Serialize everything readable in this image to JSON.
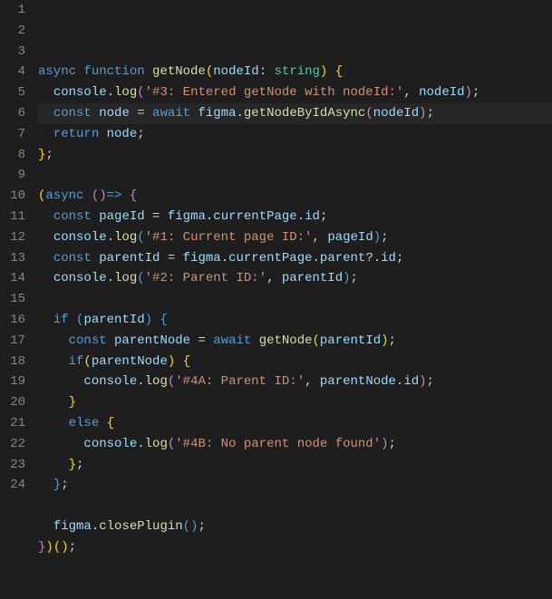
{
  "lines": [
    [
      {
        "txt": "async ",
        "cls": "tok-kw"
      },
      {
        "txt": "function ",
        "cls": "tok-kw"
      },
      {
        "txt": "getNode",
        "cls": "tok-fn"
      },
      {
        "txt": "(",
        "cls": "tok-brace"
      },
      {
        "txt": "nodeId",
        "cls": "tok-var"
      },
      {
        "txt": ": ",
        "cls": "tok-punc"
      },
      {
        "txt": "string",
        "cls": "tok-type"
      },
      {
        "txt": ") ",
        "cls": "tok-brace"
      },
      {
        "txt": "{",
        "cls": "tok-brace"
      }
    ],
    [
      {
        "txt": "  ",
        "cls": ""
      },
      {
        "txt": "console",
        "cls": "tok-var"
      },
      {
        "txt": ".",
        "cls": "tok-dot"
      },
      {
        "txt": "log",
        "cls": "tok-fn"
      },
      {
        "txt": "(",
        "cls": "tok-pur"
      },
      {
        "txt": "'#3: Entered getNode with nodeId:'",
        "cls": "tok-str"
      },
      {
        "txt": ", ",
        "cls": "tok-punc"
      },
      {
        "txt": "nodeId",
        "cls": "tok-var"
      },
      {
        "txt": ")",
        "cls": "tok-pur"
      },
      {
        "txt": ";",
        "cls": "tok-punc"
      }
    ],
    [
      {
        "txt": "  ",
        "cls": ""
      },
      {
        "txt": "const ",
        "cls": "tok-kw"
      },
      {
        "txt": "node",
        "cls": "tok-var"
      },
      {
        "txt": " = ",
        "cls": "tok-punc"
      },
      {
        "txt": "await ",
        "cls": "tok-kw"
      },
      {
        "txt": "figma",
        "cls": "tok-var"
      },
      {
        "txt": ".",
        "cls": "tok-dot"
      },
      {
        "txt": "getNodeByIdAsync",
        "cls": "tok-fn"
      },
      {
        "txt": "(",
        "cls": "tok-pur"
      },
      {
        "txt": "nodeId",
        "cls": "tok-var"
      },
      {
        "txt": ")",
        "cls": "tok-pur"
      },
      {
        "txt": ";",
        "cls": "tok-punc"
      }
    ],
    [
      {
        "txt": "  ",
        "cls": ""
      },
      {
        "txt": "return ",
        "cls": "tok-kw"
      },
      {
        "txt": "node",
        "cls": "tok-var"
      },
      {
        "txt": ";",
        "cls": "tok-punc"
      }
    ],
    [
      {
        "txt": "}",
        "cls": "tok-brace"
      },
      {
        "txt": ";",
        "cls": "tok-punc"
      }
    ],
    [],
    [
      {
        "txt": "(",
        "cls": "tok-brace"
      },
      {
        "txt": "async ",
        "cls": "tok-kw"
      },
      {
        "txt": "()",
        "cls": "tok-pur"
      },
      {
        "txt": "=> ",
        "cls": "tok-kw"
      },
      {
        "txt": "{",
        "cls": "tok-pur"
      }
    ],
    [
      {
        "txt": "  ",
        "cls": ""
      },
      {
        "txt": "const ",
        "cls": "tok-kw"
      },
      {
        "txt": "pageId",
        "cls": "tok-var"
      },
      {
        "txt": " = ",
        "cls": "tok-punc"
      },
      {
        "txt": "figma",
        "cls": "tok-var"
      },
      {
        "txt": ".",
        "cls": "tok-dot"
      },
      {
        "txt": "currentPage",
        "cls": "tok-var"
      },
      {
        "txt": ".",
        "cls": "tok-dot"
      },
      {
        "txt": "id",
        "cls": "tok-var"
      },
      {
        "txt": ";",
        "cls": "tok-punc"
      }
    ],
    [
      {
        "txt": "  ",
        "cls": ""
      },
      {
        "txt": "console",
        "cls": "tok-var"
      },
      {
        "txt": ".",
        "cls": "tok-dot"
      },
      {
        "txt": "log",
        "cls": "tok-fn"
      },
      {
        "txt": "(",
        "cls": "tok-blue"
      },
      {
        "txt": "'#1: Current page ID:'",
        "cls": "tok-str"
      },
      {
        "txt": ", ",
        "cls": "tok-punc"
      },
      {
        "txt": "pageId",
        "cls": "tok-var"
      },
      {
        "txt": ")",
        "cls": "tok-blue"
      },
      {
        "txt": ";",
        "cls": "tok-punc"
      }
    ],
    [
      {
        "txt": "  ",
        "cls": ""
      },
      {
        "txt": "const ",
        "cls": "tok-kw"
      },
      {
        "txt": "parentId",
        "cls": "tok-var"
      },
      {
        "txt": " = ",
        "cls": "tok-punc"
      },
      {
        "txt": "figma",
        "cls": "tok-var"
      },
      {
        "txt": ".",
        "cls": "tok-dot"
      },
      {
        "txt": "currentPage",
        "cls": "tok-var"
      },
      {
        "txt": ".",
        "cls": "tok-dot"
      },
      {
        "txt": "parent",
        "cls": "tok-var"
      },
      {
        "txt": "?.",
        "cls": "tok-punc"
      },
      {
        "txt": "id",
        "cls": "tok-var"
      },
      {
        "txt": ";",
        "cls": "tok-punc"
      }
    ],
    [
      {
        "txt": "  ",
        "cls": ""
      },
      {
        "txt": "console",
        "cls": "tok-var"
      },
      {
        "txt": ".",
        "cls": "tok-dot"
      },
      {
        "txt": "log",
        "cls": "tok-fn"
      },
      {
        "txt": "(",
        "cls": "tok-blue"
      },
      {
        "txt": "'#2: Parent ID:'",
        "cls": "tok-str"
      },
      {
        "txt": ", ",
        "cls": "tok-punc"
      },
      {
        "txt": "parentId",
        "cls": "tok-var"
      },
      {
        "txt": ")",
        "cls": "tok-blue"
      },
      {
        "txt": ";",
        "cls": "tok-punc"
      }
    ],
    [],
    [
      {
        "txt": "  ",
        "cls": ""
      },
      {
        "txt": "if ",
        "cls": "tok-kw"
      },
      {
        "txt": "(",
        "cls": "tok-blue"
      },
      {
        "txt": "parentId",
        "cls": "tok-var"
      },
      {
        "txt": ") ",
        "cls": "tok-blue"
      },
      {
        "txt": "{",
        "cls": "tok-blue"
      }
    ],
    [
      {
        "txt": "    ",
        "cls": ""
      },
      {
        "txt": "const ",
        "cls": "tok-kw"
      },
      {
        "txt": "parentNode",
        "cls": "tok-var"
      },
      {
        "txt": " = ",
        "cls": "tok-punc"
      },
      {
        "txt": "await ",
        "cls": "tok-kw"
      },
      {
        "txt": "getNode",
        "cls": "tok-fn"
      },
      {
        "txt": "(",
        "cls": "tok-brace"
      },
      {
        "txt": "parentId",
        "cls": "tok-var"
      },
      {
        "txt": ")",
        "cls": "tok-brace"
      },
      {
        "txt": ";",
        "cls": "tok-punc"
      }
    ],
    [
      {
        "txt": "    ",
        "cls": ""
      },
      {
        "txt": "if",
        "cls": "tok-kw"
      },
      {
        "txt": "(",
        "cls": "tok-brace"
      },
      {
        "txt": "parentNode",
        "cls": "tok-var"
      },
      {
        "txt": ") ",
        "cls": "tok-brace"
      },
      {
        "txt": "{",
        "cls": "tok-brace"
      }
    ],
    [
      {
        "txt": "      ",
        "cls": ""
      },
      {
        "txt": "console",
        "cls": "tok-var"
      },
      {
        "txt": ".",
        "cls": "tok-dot"
      },
      {
        "txt": "log",
        "cls": "tok-fn"
      },
      {
        "txt": "(",
        "cls": "tok-pur"
      },
      {
        "txt": "'#4A: Parent ID:'",
        "cls": "tok-str"
      },
      {
        "txt": ", ",
        "cls": "tok-punc"
      },
      {
        "txt": "parentNode",
        "cls": "tok-var"
      },
      {
        "txt": ".",
        "cls": "tok-dot"
      },
      {
        "txt": "id",
        "cls": "tok-var"
      },
      {
        "txt": ")",
        "cls": "tok-pur"
      },
      {
        "txt": ";",
        "cls": "tok-punc"
      }
    ],
    [
      {
        "txt": "    ",
        "cls": ""
      },
      {
        "txt": "}",
        "cls": "tok-brace"
      }
    ],
    [
      {
        "txt": "    ",
        "cls": ""
      },
      {
        "txt": "else ",
        "cls": "tok-kw"
      },
      {
        "txt": "{",
        "cls": "tok-brace"
      }
    ],
    [
      {
        "txt": "      ",
        "cls": ""
      },
      {
        "txt": "console",
        "cls": "tok-var"
      },
      {
        "txt": ".",
        "cls": "tok-dot"
      },
      {
        "txt": "log",
        "cls": "tok-fn"
      },
      {
        "txt": "(",
        "cls": "tok-pur"
      },
      {
        "txt": "'#4B: No parent node found'",
        "cls": "tok-str"
      },
      {
        "txt": ")",
        "cls": "tok-pur"
      },
      {
        "txt": ";",
        "cls": "tok-punc"
      }
    ],
    [
      {
        "txt": "    ",
        "cls": ""
      },
      {
        "txt": "}",
        "cls": "tok-brace"
      },
      {
        "txt": ";",
        "cls": "tok-punc"
      }
    ],
    [
      {
        "txt": "  ",
        "cls": ""
      },
      {
        "txt": "}",
        "cls": "tok-blue"
      },
      {
        "txt": ";",
        "cls": "tok-punc"
      }
    ],
    [],
    [
      {
        "txt": "  ",
        "cls": ""
      },
      {
        "txt": "figma",
        "cls": "tok-var"
      },
      {
        "txt": ".",
        "cls": "tok-dot"
      },
      {
        "txt": "closePlugin",
        "cls": "tok-fn"
      },
      {
        "txt": "()",
        "cls": "tok-blue"
      },
      {
        "txt": ";",
        "cls": "tok-punc"
      }
    ],
    [
      {
        "txt": "}",
        "cls": "tok-pur"
      },
      {
        "txt": ")",
        "cls": "tok-brace"
      },
      {
        "txt": "()",
        "cls": "tok-brace"
      },
      {
        "txt": ";",
        "cls": "tok-punc"
      }
    ]
  ],
  "highlight_line_index": 5
}
